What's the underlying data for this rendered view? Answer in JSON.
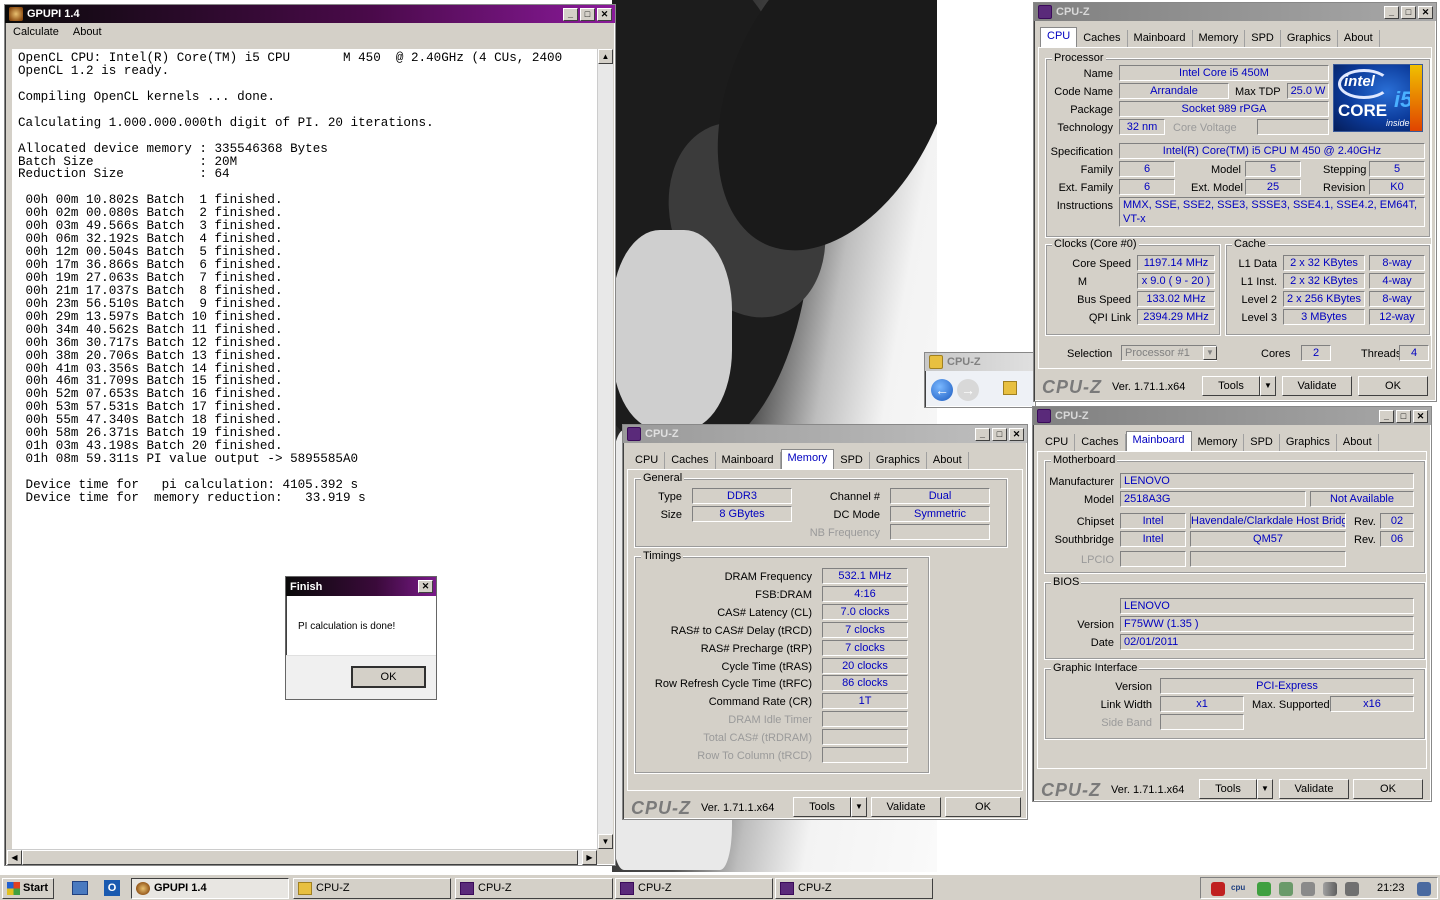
{
  "gpupi": {
    "title": "GPUPI 1.4",
    "menu": [
      "Calculate",
      "About"
    ],
    "console_lines": [
      "OpenCL CPU: Intel(R) Core(TM) i5 CPU       M 450  @ 2.40GHz (4 CUs, 2400",
      "OpenCL 1.2 is ready.",
      "",
      "Compiling OpenCL kernels ... done.",
      "",
      "Calculating 1.000.000.000th digit of PI. 20 iterations.",
      "",
      "Allocated device memory : 335546368 Bytes",
      "Batch Size              : 20M",
      "Reduction Size          : 64",
      "",
      " 00h 00m 10.802s Batch  1 finished.",
      " 00h 02m 00.080s Batch  2 finished.",
      " 00h 03m 49.566s Batch  3 finished.",
      " 00h 06m 32.192s Batch  4 finished.",
      " 00h 12m 00.504s Batch  5 finished.",
      " 00h 17m 36.866s Batch  6 finished.",
      " 00h 19m 27.063s Batch  7 finished.",
      " 00h 21m 17.037s Batch  8 finished.",
      " 00h 23m 56.510s Batch  9 finished.",
      " 00h 29m 13.597s Batch 10 finished.",
      " 00h 34m 40.562s Batch 11 finished.",
      " 00h 36m 30.717s Batch 12 finished.",
      " 00h 38m 20.706s Batch 13 finished.",
      " 00h 41m 03.356s Batch 14 finished.",
      " 00h 46m 31.709s Batch 15 finished.",
      " 00h 52m 07.653s Batch 16 finished.",
      " 00h 53m 57.531s Batch 17 finished.",
      " 00h 55m 47.340s Batch 18 finished.",
      " 00h 58m 26.371s Batch 19 finished.",
      " 01h 03m 43.198s Batch 20 finished.",
      " 01h 08m 59.311s PI value output -> 5895585A0",
      "",
      " Device time for   pi calculation: 4105.392 s",
      " Device time for  memory reduction:   33.919 s"
    ]
  },
  "finish_dialog": {
    "title": "Finish",
    "message": "PI calculation is done!",
    "ok": "OK"
  },
  "cpuz_common": {
    "title": "CPU-Z",
    "tabs": [
      "CPU",
      "Caches",
      "Mainboard",
      "Memory",
      "SPD",
      "Graphics",
      "About"
    ],
    "logo": "CPU-Z",
    "version": "Ver. 1.71.1.x64",
    "tools": "Tools",
    "validate": "Validate",
    "ok": "OK"
  },
  "cpu_tab": {
    "processor_legend": "Processor",
    "name_label": "Name",
    "name": "Intel Core i5 450M",
    "codename_label": "Code Name",
    "codename": "Arrandale",
    "maxtdp_label": "Max TDP",
    "maxtdp": "25.0 W",
    "package_label": "Package",
    "package": "Socket 989 rPGA",
    "tech_label": "Technology",
    "tech": "32 nm",
    "corevolt_label": "Core Voltage",
    "spec_label": "Specification",
    "spec": "Intel(R) Core(TM) i5 CPU       M 450  @ 2.40GHz",
    "family_label": "Family",
    "family": "6",
    "model_label": "Model",
    "model": "5",
    "stepping_label": "Stepping",
    "stepping": "5",
    "extfamily_label": "Ext. Family",
    "extfamily": "6",
    "extmodel_label": "Ext. Model",
    "extmodel": "25",
    "revision_label": "Revision",
    "revision": "K0",
    "instr_label": "Instructions",
    "instr": "MMX, SSE, SSE2, SSE3, SSSE3, SSE4.1, SSE4.2, EM64T, VT-x",
    "clocks_legend": "Clocks (Core #0)",
    "corespeed_label": "Core Speed",
    "corespeed": "1197.14 MHz",
    "mult_label": "M",
    "mult": "x 9.0 ( 9 - 20 )",
    "busspeed_label": "Bus Speed",
    "busspeed": "133.02 MHz",
    "qpi_label": "QPI Link",
    "qpi": "2394.29 MHz",
    "cache_legend": "Cache",
    "l1d_label": "L1 Data",
    "l1d": "2 x 32 KBytes",
    "l1d_way": "8-way",
    "l1i_label": "L1 Inst.",
    "l1i": "2 x 32 KBytes",
    "l1i_way": "4-way",
    "l2_label": "Level 2",
    "l2": "2 x 256 KBytes",
    "l2_way": "8-way",
    "l3_label": "Level 3",
    "l3": "3 MBytes",
    "l3_way": "12-way",
    "selection_label": "Selection",
    "selection": "Processor #1",
    "cores_label": "Cores",
    "cores": "2",
    "threads_label": "Threads",
    "threads": "4",
    "intel_logo": {
      "top": "intel",
      "mid": "CORE",
      "badge": "i5",
      "bottom": "inside"
    }
  },
  "memory_tab": {
    "general_legend": "General",
    "type_label": "Type",
    "type": "DDR3",
    "size_label": "Size",
    "size": "8 GBytes",
    "channel_label": "Channel #",
    "channel": "Dual",
    "dcmode_label": "DC Mode",
    "dcmode": "Symmetric",
    "nbfreq_label": "NB Frequency",
    "timings_legend": "Timings",
    "timings": [
      {
        "label": "DRAM Frequency",
        "value": "532.1 MHz",
        "dim": false
      },
      {
        "label": "FSB:DRAM",
        "value": "4:16",
        "dim": false
      },
      {
        "label": "CAS# Latency (CL)",
        "value": "7.0 clocks",
        "dim": false
      },
      {
        "label": "RAS# to CAS# Delay (tRCD)",
        "value": "7 clocks",
        "dim": false
      },
      {
        "label": "RAS# Precharge (tRP)",
        "value": "7 clocks",
        "dim": false
      },
      {
        "label": "Cycle Time (tRAS)",
        "value": "20 clocks",
        "dim": false
      },
      {
        "label": "Row Refresh Cycle Time (tRFC)",
        "value": "86 clocks",
        "dim": false
      },
      {
        "label": "Command Rate (CR)",
        "value": "1T",
        "dim": false
      },
      {
        "label": "DRAM Idle Timer",
        "value": "",
        "dim": true
      },
      {
        "label": "Total CAS# (tRDRAM)",
        "value": "",
        "dim": true
      },
      {
        "label": "Row To Column (tRCD)",
        "value": "",
        "dim": true
      }
    ]
  },
  "mainboard_tab": {
    "mb_legend": "Motherboard",
    "manu_label": "Manufacturer",
    "manu": "LENOVO",
    "model_label": "Model",
    "model": "2518A3G",
    "model2": "Not Available",
    "chipset_label": "Chipset",
    "chipset": "Intel",
    "chipset2": "Havendale/Clarkdale Host Bridge",
    "rev_label": "Rev.",
    "chipset_rev": "02",
    "sb_label": "Southbridge",
    "sb": "Intel",
    "sb2": "QM57",
    "sb_rev": "06",
    "lpcio_label": "LPCIO",
    "bios_legend": "BIOS",
    "bios_brand": "LENOVO",
    "version_label": "Version",
    "version": "F75WW (1.35 )",
    "date_label": "Date",
    "date": "02/01/2011",
    "gi_legend": "Graphic Interface",
    "gi_version_label": "Version",
    "gi_version": "PCI-Express",
    "linkwidth_label": "Link Width",
    "linkwidth": "x1",
    "maxsup_label": "Max. Supported",
    "maxsup": "x16",
    "sideband_label": "Side Band"
  },
  "explorer": {
    "title": "CPU-Z"
  },
  "taskbar": {
    "start": "Start",
    "items": [
      "GPUPI 1.4",
      "CPU-Z",
      "CPU-Z",
      "CPU-Z",
      "CPU-Z"
    ],
    "clock": "21:23",
    "cpu_tray": "cpu"
  },
  "colors": {
    "value_text": "#0000c0",
    "title_active": "#4a0a4a",
    "window_face": "#d4d0c8"
  }
}
